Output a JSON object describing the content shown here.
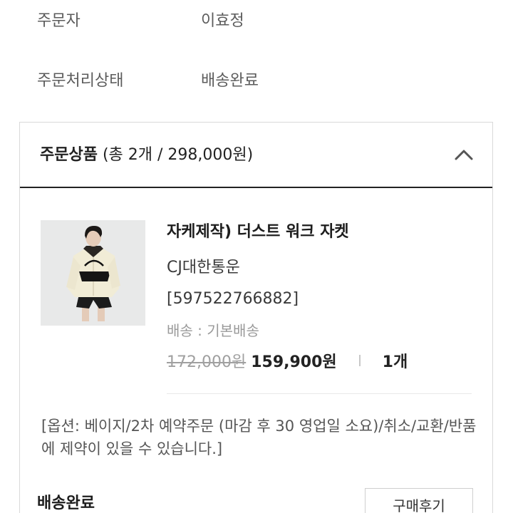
{
  "order_info": {
    "orderer_label": "주문자",
    "orderer_value": "이효정",
    "status_label": "주문처리상태",
    "status_value": "배송완료"
  },
  "order_items": {
    "header_title": "주문상품",
    "header_summary": "(총 2개 / 298,000원)",
    "collapse_icon": "chevron-up-icon"
  },
  "product": {
    "name": "자케제작) 더스트 워크 자켓",
    "courier": "CJ대한통운",
    "tracking_number": "[597522766882]",
    "shipping": "배송 : 기본배송",
    "original_price": "172,000원",
    "sale_price": "159,900원",
    "quantity": "1개",
    "option_note": "[옵션: 베이지/2차 예약주문 (마감 후 30 영업일 소요)/취소/교환/반품에 제약이 있을 수 있습니다.]"
  },
  "footer": {
    "delivery_status": "배송완료",
    "review_button": "구매후기"
  }
}
